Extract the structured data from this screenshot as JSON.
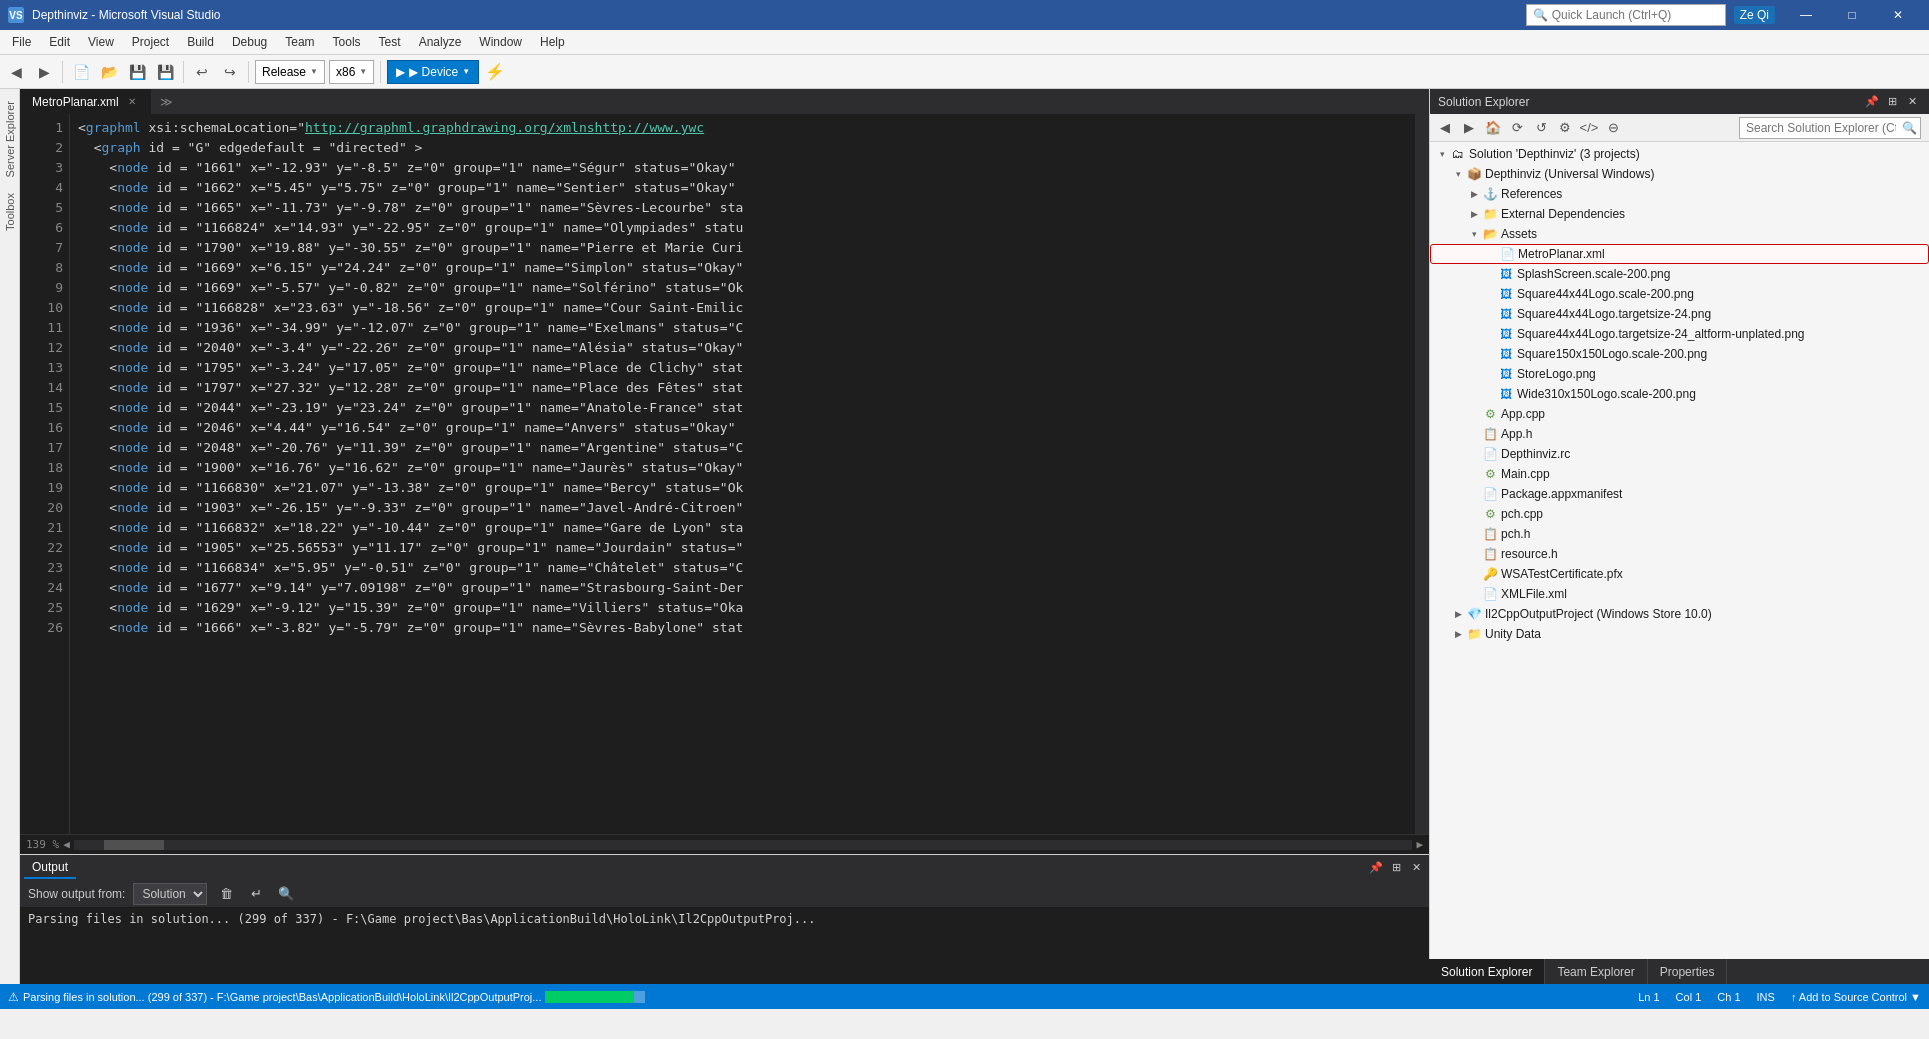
{
  "titleBar": {
    "icon": "VS",
    "title": "Depthinviz - Microsoft Visual Studio",
    "buttons": {
      "minimize": "—",
      "maximize": "□",
      "close": "✕"
    }
  },
  "menuBar": {
    "items": [
      "File",
      "Edit",
      "View",
      "Project",
      "Build",
      "Debug",
      "Team",
      "Tools",
      "Test",
      "Analyze",
      "Window",
      "Help"
    ]
  },
  "toolbar": {
    "backLabel": "◄",
    "forwardLabel": "►",
    "config": "Release",
    "platform": "x86",
    "runLabel": "▶ Device",
    "attachLabel": "⚡"
  },
  "editorTab": {
    "filename": "MetroPlanar.xml",
    "isActive": true
  },
  "codeLines": [
    {
      "num": 1,
      "content": "<graphml xsi:schemaLocation=\"http://graphml.graphdrawing.org/xmlns http://www.ywc"
    },
    {
      "num": 2,
      "content": "  <graph id = \"G\" edgedefault = \"directed\" >"
    },
    {
      "num": 3,
      "content": "    <node id = \"1661\" x=\"-12.93\" y=\"-8.5\" z=\"0\" group=\"1\" name=\"Ségur\" status=\"Okay\""
    },
    {
      "num": 4,
      "content": "    <node id = \"1662\" x=\"5.45\" y=\"5.75\" z=\"0\" group=\"1\" name=\"Sentier\" status=\"Okay\""
    },
    {
      "num": 5,
      "content": "    <node id = \"1665\" x=\"-11.73\" y=\"-9.78\" z=\"0\" group=\"1\" name=\"Sèvres-Lecourbe\" sta"
    },
    {
      "num": 6,
      "content": "    <node id = \"1166824\" x=\"14.93\" y=\"-22.95\" z=\"0\" group=\"1\" name=\"Olympiades\" statu"
    },
    {
      "num": 7,
      "content": "    <node id = \"1790\" x=\"19.88\" y=\"-30.55\" z=\"0\" group=\"1\" name=\"Pierre et Marie Curi"
    },
    {
      "num": 8,
      "content": "    <node id = \"1669\" x=\"6.15\" y=\"24.24\" z=\"0\" group=\"1\" name=\"Simplon\" status=\"Okay\""
    },
    {
      "num": 9,
      "content": "    <node id = \"1669\" x=\"-5.57\" y=\"-0.82\" z=\"0\" group=\"1\" name=\"Solférino\" status=\"Ok"
    },
    {
      "num": 10,
      "content": "    <node id = \"1166828\" x=\"23.63\" y=\"-18.56\" z=\"0\" group=\"1\" name=\"Cour Saint-Emilic"
    },
    {
      "num": 11,
      "content": "    <node id = \"1936\" x=\"-34.99\" y=\"-12.07\" z=\"0\" group=\"1\" name=\"Exelmans\" status=\"C"
    },
    {
      "num": 12,
      "content": "    <node id = \"2040\" x=\"-3.4\" y=\"-22.26\" z=\"0\" group=\"1\" name=\"Alésia\" status=\"Okay\""
    },
    {
      "num": 13,
      "content": "    <node id = \"1795\" x=\"-3.24\" y=\"17.05\" z=\"0\" group=\"1\" name=\"Place de Clichy\" stat"
    },
    {
      "num": 14,
      "content": "    <node id = \"1797\" x=\"27.32\" y=\"12.28\" z=\"0\" group=\"1\" name=\"Place des Fêtes\" stat"
    },
    {
      "num": 15,
      "content": "    <node id = \"2044\" x=\"-23.19\" y=\"23.24\" z=\"0\" group=\"1\" name=\"Anatole-France\" stat"
    },
    {
      "num": 16,
      "content": "    <node id = \"2046\" x=\"4.44\" y=\"16.54\" z=\"0\" group=\"1\" name=\"Anvers\" status=\"Okay\""
    },
    {
      "num": 17,
      "content": "    <node id = \"2048\" x=\"-20.76\" y=\"11.39\" z=\"0\" group=\"1\" name=\"Argentine\" status=\"C"
    },
    {
      "num": 18,
      "content": "    <node id = \"1900\" x=\"16.76\" y=\"16.62\" z=\"0\" group=\"1\" name=\"Jaurès\" status=\"Okay\""
    },
    {
      "num": 19,
      "content": "    <node id = \"1166830\" x=\"21.07\" y=\"-13.38\" z=\"0\" group=\"1\" name=\"Bercy\" status=\"Ok"
    },
    {
      "num": 20,
      "content": "    <node id = \"1903\" x=\"-26.15\" y=\"-9.33\" z=\"0\" group=\"1\" name=\"Javel-André-Citroen\""
    },
    {
      "num": 21,
      "content": "    <node id = \"1166832\" x=\"18.22\" y=\"-10.44\" z=\"0\" group=\"1\" name=\"Gare de Lyon\" sta"
    },
    {
      "num": 22,
      "content": "    <node id = \"1905\" x=\"25.56553\" y=\"11.17\" z=\"0\" group=\"1\" name=\"Jourdain\" status=\""
    },
    {
      "num": 23,
      "content": "    <node id = \"1166834\" x=\"5.95\" y=\"-0.51\" z=\"0\" group=\"1\" name=\"Châtelet\" status=\"C"
    },
    {
      "num": 24,
      "content": "    <node id = \"1677\" x=\"9.14\" y=\"7.09198\" z=\"0\" group=\"1\" name=\"Strasbourg-Saint-Der"
    },
    {
      "num": 25,
      "content": "    <node id = \"1629\" x=\"-9.12\" y=\"15.39\" z=\"0\" group=\"1\" name=\"Villiers\" status=\"Oka"
    },
    {
      "num": 26,
      "content": "    <node id = \"1666\" x=\"-3.82\" y=\"-5.79\" z=\"0\" group=\"1\" name=\"Sèvres-Babylone\" stat"
    }
  ],
  "zoomLevel": "139 %",
  "solutionExplorer": {
    "title": "Solution Explorer",
    "searchPlaceholder": "Search Solution Explorer (Ctrl+;)",
    "tree": {
      "solution": "Solution 'Depthinviz' (3 projects)",
      "projects": [
        {
          "name": "Depthinviz (Universal Windows)",
          "expanded": true,
          "children": [
            {
              "name": "References",
              "type": "references",
              "expanded": false
            },
            {
              "name": "External Dependencies",
              "type": "folder",
              "expanded": false
            },
            {
              "name": "Assets",
              "type": "folder",
              "expanded": true,
              "children": [
                {
                  "name": "MetroPlanar.xml",
                  "type": "xml",
                  "highlighted": true
                },
                {
                  "name": "SplashScreen.scale-200.png",
                  "type": "image"
                },
                {
                  "name": "Square44x44Logo.scale-200.png",
                  "type": "image"
                },
                {
                  "name": "Square44x44Logo.targetsize-24.png",
                  "type": "image"
                },
                {
                  "name": "Square44x44Logo.targetsize-24_altform-unplated.png",
                  "type": "image"
                },
                {
                  "name": "Square150x150Logo.scale-200.png",
                  "type": "image"
                },
                {
                  "name": "StoreLogo.png",
                  "type": "image"
                },
                {
                  "name": "Wide310x150Logo.scale-200.png",
                  "type": "image"
                }
              ]
            },
            {
              "name": "App.cpp",
              "type": "cpp"
            },
            {
              "name": "App.h",
              "type": "header"
            },
            {
              "name": "Depthinviz.rc",
              "type": "rc"
            },
            {
              "name": "Main.cpp",
              "type": "cpp"
            },
            {
              "name": "Package.appxmanifest",
              "type": "manifest"
            },
            {
              "name": "pch.cpp",
              "type": "cpp"
            },
            {
              "name": "pch.h",
              "type": "header"
            },
            {
              "name": "resource.h",
              "type": "header"
            },
            {
              "name": "WSATestCertificate.pfx",
              "type": "pfx"
            },
            {
              "name": "XMLFile.xml",
              "type": "xml"
            }
          ]
        },
        {
          "name": "Il2CppOutputProject (Windows Store 10.0)",
          "type": "project",
          "expanded": false
        },
        {
          "name": "Unity Data",
          "type": "folder",
          "expanded": false
        }
      ]
    }
  },
  "outputPanel": {
    "title": "Output",
    "showOutputFrom": "Show output from:",
    "source": "Solution",
    "content": "Parsing files in solution... (299 of 337) - F:\\Game project\\Bas\\ApplicationBuild\\HoloLink\\Il2CppOutputProj..."
  },
  "statusBar": {
    "message": "Parsing files in solution... (299 of 337) - F:\\Game project\\Bas\\ApplicationBuild\\HoloLink\\Il2CppOutputProj...",
    "progressPercent": 89,
    "ln": "Ln 1",
    "col": "Col 1",
    "ch": "Ch 1",
    "ins": "INS"
  },
  "bottomTabs": {
    "items": [
      "Solution Explorer",
      "Team Explorer",
      "Properties"
    ]
  },
  "quickLaunch": {
    "placeholder": "Quick Launch (Ctrl+Q)"
  },
  "userInitials": "Ze Qi"
}
